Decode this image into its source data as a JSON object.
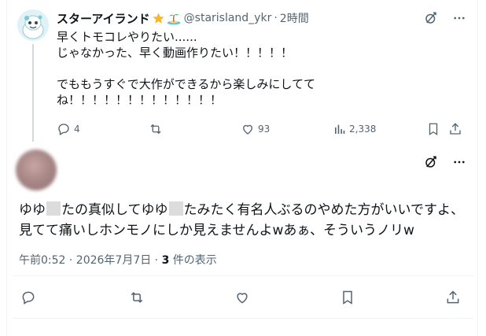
{
  "parent_tweet": {
    "display_name": "スターアイランド",
    "emojis": [
      "star-emoji",
      "island-emoji"
    ],
    "handle": "@starisland_ykr",
    "separator": "·",
    "time": "2時間",
    "text_lines": [
      "早くトモコレやりたい......",
      "じゃなかった、早く動画作りたい！！！！！",
      "",
      "でももうすぐで大作ができるから楽しみにしてて",
      "ね！！！！！！！！！！！！！"
    ],
    "actions": {
      "reply_count": "4",
      "retweet_count": "",
      "like_count": "93",
      "view_count": "2,338"
    }
  },
  "reply_tweet": {
    "text_line1_a": "ゆゆ",
    "text_line1_b": "たの真似してゆゆ",
    "text_line1_c": "たみたく有名人ぶるのやめた方がいいですよ、",
    "text_line2": "見てて痛いしホンモノにしか見えませんよwあぁ、そういうノリw",
    "timestamp": "午前0:52 · 2026年7月7日 · ",
    "views_count": "3",
    "views_label": " 件の表示"
  },
  "colors": {
    "text_primary": "#0f1419",
    "text_secondary": "#536471",
    "divider": "#eff3f4",
    "thread_line": "#cfd9de"
  }
}
